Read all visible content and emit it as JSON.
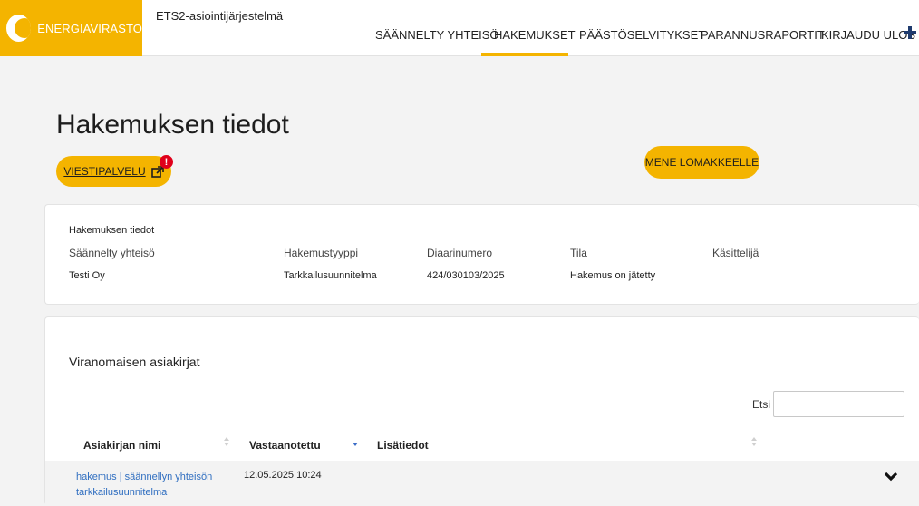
{
  "header": {
    "logo_text": "ENERGIAVIRASTO",
    "system_name": "ETS2-asiointijärjestelmä",
    "nav": [
      {
        "label": "SÄÄNNELTY YHTEISÖ",
        "icon": ""
      },
      {
        "label": "HAKEMUKSET",
        "active": true
      },
      {
        "label": "PÄÄSTÖSELVITYKSET"
      },
      {
        "label": "PARANNUSRAPORTIT"
      },
      {
        "label": "KIRJAUDU ULOS"
      }
    ],
    "extra_icon": "plus-icon",
    "accent_color": "#f4b400"
  },
  "page": {
    "title": "Hakemuksen tiedot",
    "viestipalvelu_label": "VIESTIPALVELU",
    "notification_badge": "!",
    "mene_label": "MENE LOMAKKEELLE"
  },
  "info": {
    "title": "Hakemuksen tiedot",
    "columns": [
      {
        "label": "Säännelty yhteisö",
        "value": "Testi Oy"
      },
      {
        "label": "Hakemustyyppi",
        "value": "Tarkkailusuunnitelma"
      },
      {
        "label": "Diaarinumero",
        "value": "424/030103/2025"
      },
      {
        "label": "Tila",
        "value": "Hakemus on jätetty"
      },
      {
        "label": "Käsittelijä",
        "value": ""
      }
    ]
  },
  "docs": {
    "title": "Viranomaisen asiakirjat",
    "search_label": "Etsi",
    "search_value": "",
    "headers": [
      "Asiakirjan nimi",
      "Vastaanotettu",
      "Lisätiedot"
    ],
    "rows": [
      {
        "name": "hakemus | säännellyn yhteisön tarkkailusuunnitelma",
        "received": "12.05.2025 10:24",
        "details": ""
      }
    ]
  }
}
